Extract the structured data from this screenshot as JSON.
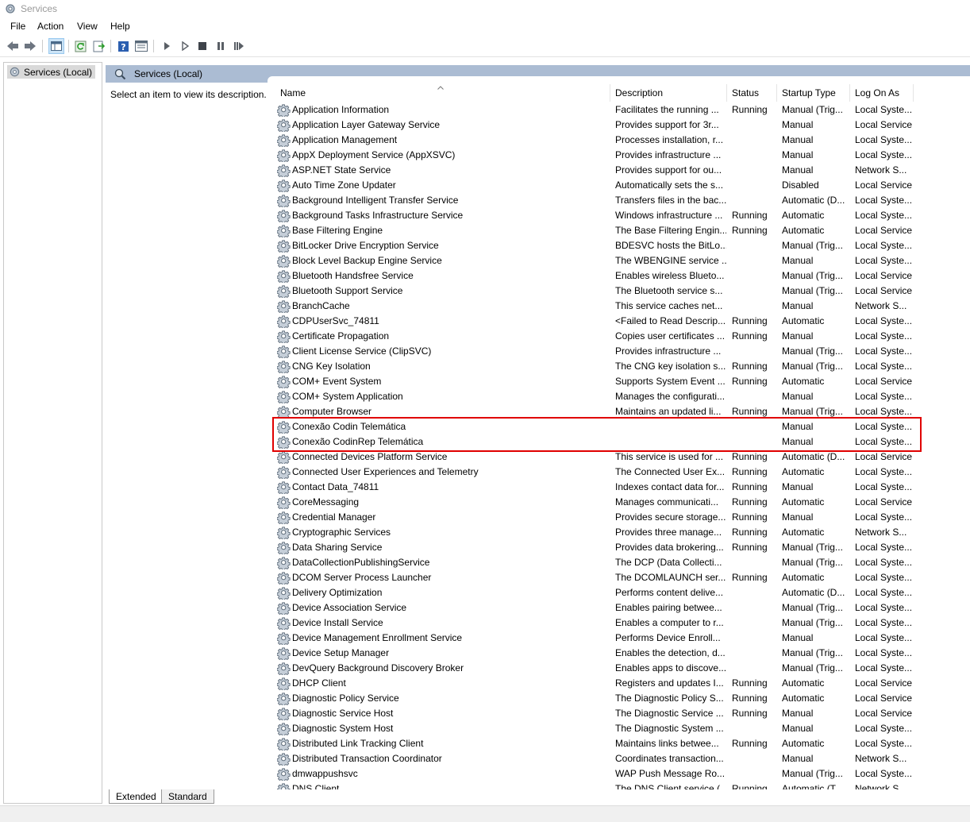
{
  "window": {
    "title": "Services"
  },
  "menu": [
    "File",
    "Action",
    "View",
    "Help"
  ],
  "toolbar_icons": [
    "back-icon",
    "forward-icon",
    "show-hide-tree-icon",
    "refresh-icon",
    "export-list-icon",
    "help-icon",
    "properties-icon",
    "start-service-icon",
    "start-service-alt-icon",
    "stop-service-icon",
    "pause-service-icon",
    "restart-service-icon"
  ],
  "tree": {
    "root_label": "Services (Local)"
  },
  "pane": {
    "title": "Services (Local)",
    "description_prompt": "Select an item to view its description."
  },
  "columns": {
    "name": "Name",
    "description": "Description",
    "status": "Status",
    "startup": "Startup Type",
    "logon": "Log On As"
  },
  "services": [
    {
      "name": "Application Information",
      "description": "Facilitates the running ...",
      "status": "Running",
      "startup": "Manual (Trig...",
      "logon": "Local Syste..."
    },
    {
      "name": "Application Layer Gateway Service",
      "description": "Provides support for 3r...",
      "status": "",
      "startup": "Manual",
      "logon": "Local Service"
    },
    {
      "name": "Application Management",
      "description": "Processes installation, r...",
      "status": "",
      "startup": "Manual",
      "logon": "Local Syste..."
    },
    {
      "name": "AppX Deployment Service (AppXSVC)",
      "description": "Provides infrastructure ...",
      "status": "",
      "startup": "Manual",
      "logon": "Local Syste..."
    },
    {
      "name": "ASP.NET State Service",
      "description": "Provides support for ou...",
      "status": "",
      "startup": "Manual",
      "logon": "Network S..."
    },
    {
      "name": "Auto Time Zone Updater",
      "description": "Automatically sets the s...",
      "status": "",
      "startup": "Disabled",
      "logon": "Local Service"
    },
    {
      "name": "Background Intelligent Transfer Service",
      "description": "Transfers files in the bac...",
      "status": "",
      "startup": "Automatic (D...",
      "logon": "Local Syste..."
    },
    {
      "name": "Background Tasks Infrastructure Service",
      "description": "Windows infrastructure ...",
      "status": "Running",
      "startup": "Automatic",
      "logon": "Local Syste..."
    },
    {
      "name": "Base Filtering Engine",
      "description": "The Base Filtering Engin...",
      "status": "Running",
      "startup": "Automatic",
      "logon": "Local Service"
    },
    {
      "name": "BitLocker Drive Encryption Service",
      "description": "BDESVC hosts the BitLo...",
      "status": "",
      "startup": "Manual (Trig...",
      "logon": "Local Syste..."
    },
    {
      "name": "Block Level Backup Engine Service",
      "description": "The WBENGINE service ...",
      "status": "",
      "startup": "Manual",
      "logon": "Local Syste..."
    },
    {
      "name": "Bluetooth Handsfree Service",
      "description": "Enables wireless Blueto...",
      "status": "",
      "startup": "Manual (Trig...",
      "logon": "Local Service"
    },
    {
      "name": "Bluetooth Support Service",
      "description": "The Bluetooth service s...",
      "status": "",
      "startup": "Manual (Trig...",
      "logon": "Local Service"
    },
    {
      "name": "BranchCache",
      "description": "This service caches net...",
      "status": "",
      "startup": "Manual",
      "logon": "Network S..."
    },
    {
      "name": "CDPUserSvc_74811",
      "description": "<Failed to Read Descrip...",
      "status": "Running",
      "startup": "Automatic",
      "logon": "Local Syste..."
    },
    {
      "name": "Certificate Propagation",
      "description": "Copies user certificates ...",
      "status": "Running",
      "startup": "Manual",
      "logon": "Local Syste..."
    },
    {
      "name": "Client License Service (ClipSVC)",
      "description": "Provides infrastructure ...",
      "status": "",
      "startup": "Manual (Trig...",
      "logon": "Local Syste..."
    },
    {
      "name": "CNG Key Isolation",
      "description": "The CNG key isolation s...",
      "status": "Running",
      "startup": "Manual (Trig...",
      "logon": "Local Syste..."
    },
    {
      "name": "COM+ Event System",
      "description": "Supports System Event ...",
      "status": "Running",
      "startup": "Automatic",
      "logon": "Local Service"
    },
    {
      "name": "COM+ System Application",
      "description": "Manages the configurati...",
      "status": "",
      "startup": "Manual",
      "logon": "Local Syste..."
    },
    {
      "name": "Computer Browser",
      "description": "Maintains an updated li...",
      "status": "Running",
      "startup": "Manual (Trig...",
      "logon": "Local Syste..."
    },
    {
      "name": "Conexão Codin Telemática",
      "description": "",
      "status": "",
      "startup": "Manual",
      "logon": "Local Syste..."
    },
    {
      "name": "Conexão CodinRep Telemática",
      "description": "",
      "status": "",
      "startup": "Manual",
      "logon": "Local Syste..."
    },
    {
      "name": "Connected Devices Platform Service",
      "description": "This service is used for ...",
      "status": "Running",
      "startup": "Automatic (D...",
      "logon": "Local Service"
    },
    {
      "name": "Connected User Experiences and Telemetry",
      "description": "The Connected User Ex...",
      "status": "Running",
      "startup": "Automatic",
      "logon": "Local Syste..."
    },
    {
      "name": "Contact Data_74811",
      "description": "Indexes contact data for...",
      "status": "Running",
      "startup": "Manual",
      "logon": "Local Syste..."
    },
    {
      "name": "CoreMessaging",
      "description": "Manages communicati...",
      "status": "Running",
      "startup": "Automatic",
      "logon": "Local Service"
    },
    {
      "name": "Credential Manager",
      "description": "Provides secure storage...",
      "status": "Running",
      "startup": "Manual",
      "logon": "Local Syste..."
    },
    {
      "name": "Cryptographic Services",
      "description": "Provides three manage...",
      "status": "Running",
      "startup": "Automatic",
      "logon": "Network S..."
    },
    {
      "name": "Data Sharing Service",
      "description": "Provides data brokering...",
      "status": "Running",
      "startup": "Manual (Trig...",
      "logon": "Local Syste..."
    },
    {
      "name": "DataCollectionPublishingService",
      "description": "The DCP (Data Collecti...",
      "status": "",
      "startup": "Manual (Trig...",
      "logon": "Local Syste..."
    },
    {
      "name": "DCOM Server Process Launcher",
      "description": "The DCOMLAUNCH ser...",
      "status": "Running",
      "startup": "Automatic",
      "logon": "Local Syste..."
    },
    {
      "name": "Delivery Optimization",
      "description": "Performs content delive...",
      "status": "",
      "startup": "Automatic (D...",
      "logon": "Local Syste..."
    },
    {
      "name": "Device Association Service",
      "description": "Enables pairing betwee...",
      "status": "",
      "startup": "Manual (Trig...",
      "logon": "Local Syste..."
    },
    {
      "name": "Device Install Service",
      "description": "Enables a computer to r...",
      "status": "",
      "startup": "Manual (Trig...",
      "logon": "Local Syste..."
    },
    {
      "name": "Device Management Enrollment Service",
      "description": "Performs Device Enroll...",
      "status": "",
      "startup": "Manual",
      "logon": "Local Syste..."
    },
    {
      "name": "Device Setup Manager",
      "description": "Enables the detection, d...",
      "status": "",
      "startup": "Manual (Trig...",
      "logon": "Local Syste..."
    },
    {
      "name": "DevQuery Background Discovery Broker",
      "description": "Enables apps to discove...",
      "status": "",
      "startup": "Manual (Trig...",
      "logon": "Local Syste..."
    },
    {
      "name": "DHCP Client",
      "description": "Registers and updates I...",
      "status": "Running",
      "startup": "Automatic",
      "logon": "Local Service"
    },
    {
      "name": "Diagnostic Policy Service",
      "description": "The Diagnostic Policy S...",
      "status": "Running",
      "startup": "Automatic",
      "logon": "Local Service"
    },
    {
      "name": "Diagnostic Service Host",
      "description": "The Diagnostic Service ...",
      "status": "Running",
      "startup": "Manual",
      "logon": "Local Service"
    },
    {
      "name": "Diagnostic System Host",
      "description": "The Diagnostic System ...",
      "status": "",
      "startup": "Manual",
      "logon": "Local Syste..."
    },
    {
      "name": "Distributed Link Tracking Client",
      "description": "Maintains links betwee...",
      "status": "Running",
      "startup": "Automatic",
      "logon": "Local Syste..."
    },
    {
      "name": "Distributed Transaction Coordinator",
      "description": "Coordinates transaction...",
      "status": "",
      "startup": "Manual",
      "logon": "Network S..."
    },
    {
      "name": "dmwappushsvc",
      "description": "WAP Push Message Ro...",
      "status": "",
      "startup": "Manual (Trig...",
      "logon": "Local Syste..."
    },
    {
      "name": "DNS Client",
      "description": "The DNS Client service (...",
      "status": "Running",
      "startup": "Automatic (T...",
      "logon": "Network S..."
    }
  ],
  "bottom_tabs": {
    "extended": "Extended",
    "standard": "Standard"
  }
}
